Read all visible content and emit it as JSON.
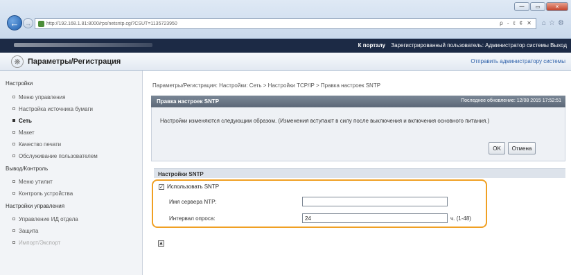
{
  "browser": {
    "url": "http://192.168.1.81:8000/rps/netsntp.cgi?CSUT=1135723950",
    "back_icon": "back-arrow-icon",
    "forward_icon": "forward-arrow-icon",
    "address_icons": "ρ - ℓ ¢ ✕",
    "window_buttons": {
      "minimize": "—",
      "maximize": "▭",
      "close": "✕"
    }
  },
  "topbar": {
    "portal": "К порталу",
    "user_text": "Зарегистрированный пользователь: Администратор системы Выход"
  },
  "header": {
    "title": "Параметры/Регистрация",
    "send_admin": "Отправить администратору системы"
  },
  "sidebar": {
    "section_settings": "Настройки",
    "items_settings": [
      "Меню управления",
      "Настройка источника бумаги",
      "Сеть",
      "Макет",
      "Качество печати",
      "Обслуживание пользователем"
    ],
    "section_output": "Вывод/Контроль",
    "items_output": [
      "Меню утилит",
      "Контроль устройства"
    ],
    "section_manage": "Настройки управления",
    "items_manage": [
      "Управление ИД отдела",
      "Защита",
      "Импорт/Экспорт"
    ]
  },
  "main": {
    "breadcrumb": "Параметры/Регистрация: Настройки: Сеть > Настройки TCP/IP > Правка настроек SNTP",
    "panel_title": "Правка настроек SNTP",
    "last_updated": "Последнее обновление: 12/08 2015 17:52:51",
    "message": "Настройки изменяются следующим образом. (Изменения вступают в силу после выключения и включения основного питания.)",
    "ok_label": "OK",
    "cancel_label": "Отмена",
    "section_title": "Настройки SNTP",
    "use_sntp_label": "Использовать SNTP",
    "use_sntp_checked": true,
    "ntp_server_label": "Имя сервера NTP:",
    "ntp_server_value": "",
    "poll_interval_label": "Интервал опроса:",
    "poll_interval_value": "24",
    "poll_interval_unit": "ч. (1-48)"
  },
  "colors": {
    "highlight": "#f0a023",
    "topbar": "#1c2a45",
    "panel_header": "#66727f"
  }
}
